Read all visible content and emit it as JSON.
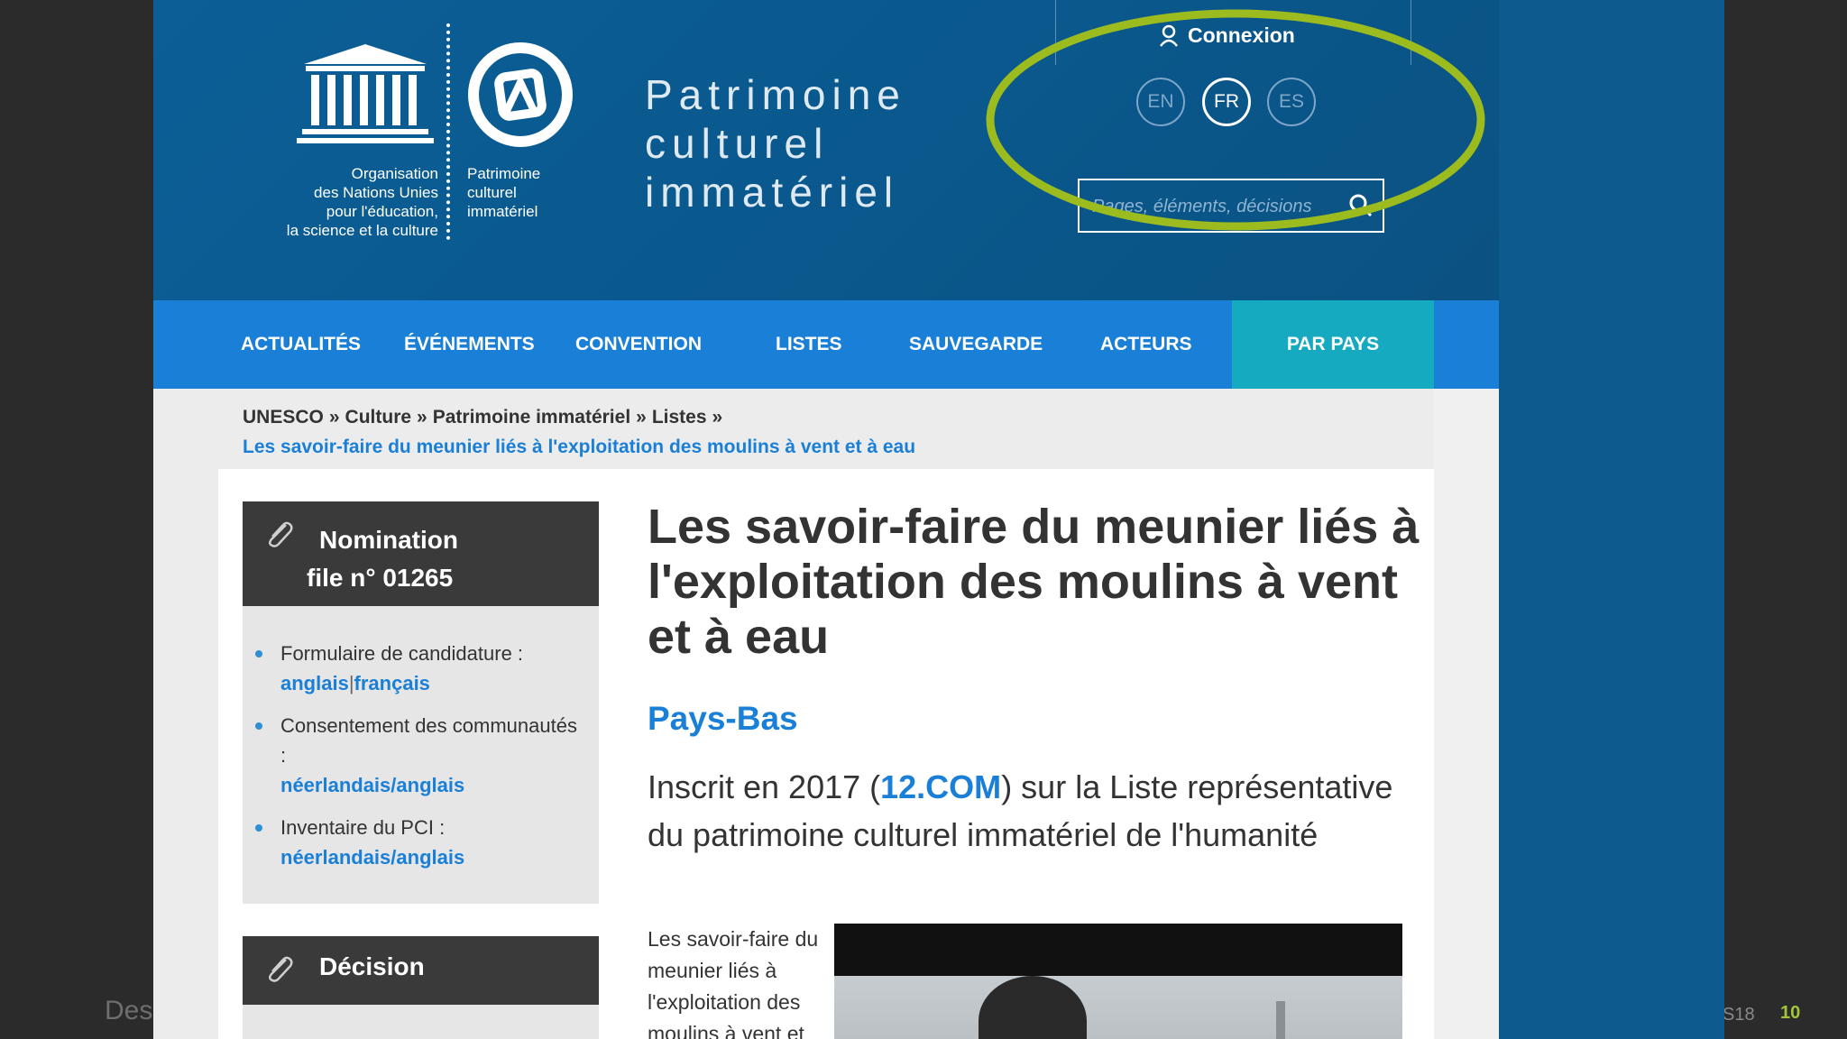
{
  "slide": {
    "left_text": "Desi",
    "year": "S18",
    "page_number": "10"
  },
  "header": {
    "unesco_wordmark": "UNESCO",
    "org_lines": [
      "Organisation",
      "des Nations Unies",
      "pour l'éducation,",
      "la science et la culture"
    ],
    "ich_lines": [
      "Patrimoine",
      "culturel",
      "immatériel"
    ],
    "site_title_lines": [
      "Patrimoine",
      "culturel",
      "immatériel"
    ],
    "connexion_label": "Connexion",
    "languages": [
      "EN",
      "FR",
      "ES"
    ],
    "active_language": "FR",
    "search_placeholder": "Pages, éléments, décisions"
  },
  "nav": {
    "items": [
      "ACTUALITÉS",
      "ÉVÉNEMENTS",
      "CONVENTION",
      "LISTES",
      "SAUVEGARDE",
      "ACTEURS",
      "PAR PAYS"
    ],
    "active": "PAR PAYS"
  },
  "breadcrumb": {
    "items": [
      "UNESCO",
      "Culture",
      "Patrimoine immatériel",
      "Listes"
    ],
    "separator": "»",
    "current": "Les savoir-faire du meunier liés à l'exploitation des moulins à vent et à eau"
  },
  "sidebar": {
    "nomination_title": "Nomination",
    "nomination_file": "file n° 01265",
    "items": [
      {
        "label": "Formulaire de candidature :",
        "links": [
          "anglais",
          "français"
        ],
        "link_sep": "|"
      },
      {
        "label": "Consentement des communautés :",
        "links": [
          "néerlandais/anglais"
        ]
      },
      {
        "label": "Inventaire du PCI :",
        "links": [
          "néerlandais/anglais"
        ]
      }
    ],
    "decision_title": "Décision"
  },
  "main": {
    "title": "Les savoir-faire du meunier liés à l'exploitation des moulins à vent et à eau",
    "country": "Pays-Bas",
    "inscribed_prefix": "Inscrit en 2017 (",
    "inscribed_link": "12.COM",
    "inscribed_suffix": ") sur la Liste représentative du patrimoine culturel immatériel de l'humanité",
    "description": "Les savoir-faire du meunier liés à l'exploitation des moulins à vent et"
  },
  "colors": {
    "header_bg": "#0a588d",
    "nav_bg": "#1a7fd6",
    "nav_active_bg": "#15aabf",
    "link_blue": "#1a7fd6",
    "highlight_ring": "#9bbb1e",
    "sidebar_head_bg": "#3a3a3a"
  }
}
